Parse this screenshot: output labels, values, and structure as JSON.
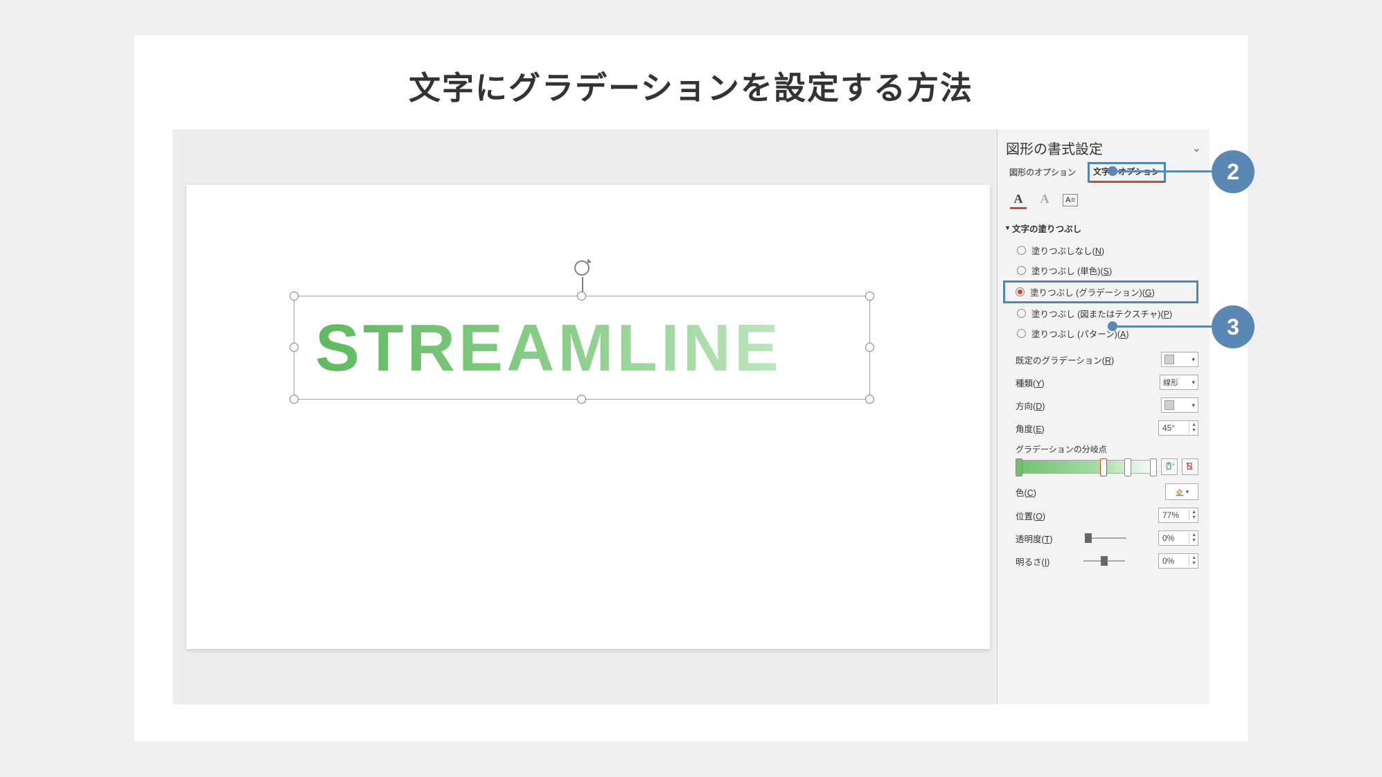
{
  "title": "文字にグラデーションを設定する方法",
  "canvasText": "STREAMLINE",
  "panel": {
    "title": "図形の書式設定",
    "tabs": {
      "shape": "図形のオプション",
      "text": "文字のオプション"
    },
    "fillSection": "文字の塗りつぶし",
    "fillOptions": {
      "none": "塗りつぶしなし",
      "solid": "塗りつぶし (単色)",
      "gradient": "塗りつぶし (グラデーション)",
      "picture": "塗りつぶし (図またはテクスチャ)",
      "pattern": "塗りつぶし (パターン)"
    },
    "mnemonics": {
      "none": "N",
      "solid": "S",
      "gradient": "G",
      "picture": "P",
      "pattern": "A",
      "preset": "R",
      "type": "Y",
      "direction": "D",
      "angle": "E",
      "color": "C",
      "position": "O",
      "transparency": "T",
      "brightness": "I"
    },
    "labels": {
      "preset": "既定のグラデーション",
      "type": "種類",
      "direction": "方向",
      "angle": "角度",
      "stops": "グラデーションの分岐点",
      "color": "色",
      "position": "位置",
      "transparency": "透明度",
      "brightness": "明るさ"
    },
    "values": {
      "type": "線形",
      "angle": "45°",
      "position": "77%",
      "transparency": "0%",
      "brightness": "0%"
    }
  },
  "callouts": {
    "two": "2",
    "three": "3"
  }
}
